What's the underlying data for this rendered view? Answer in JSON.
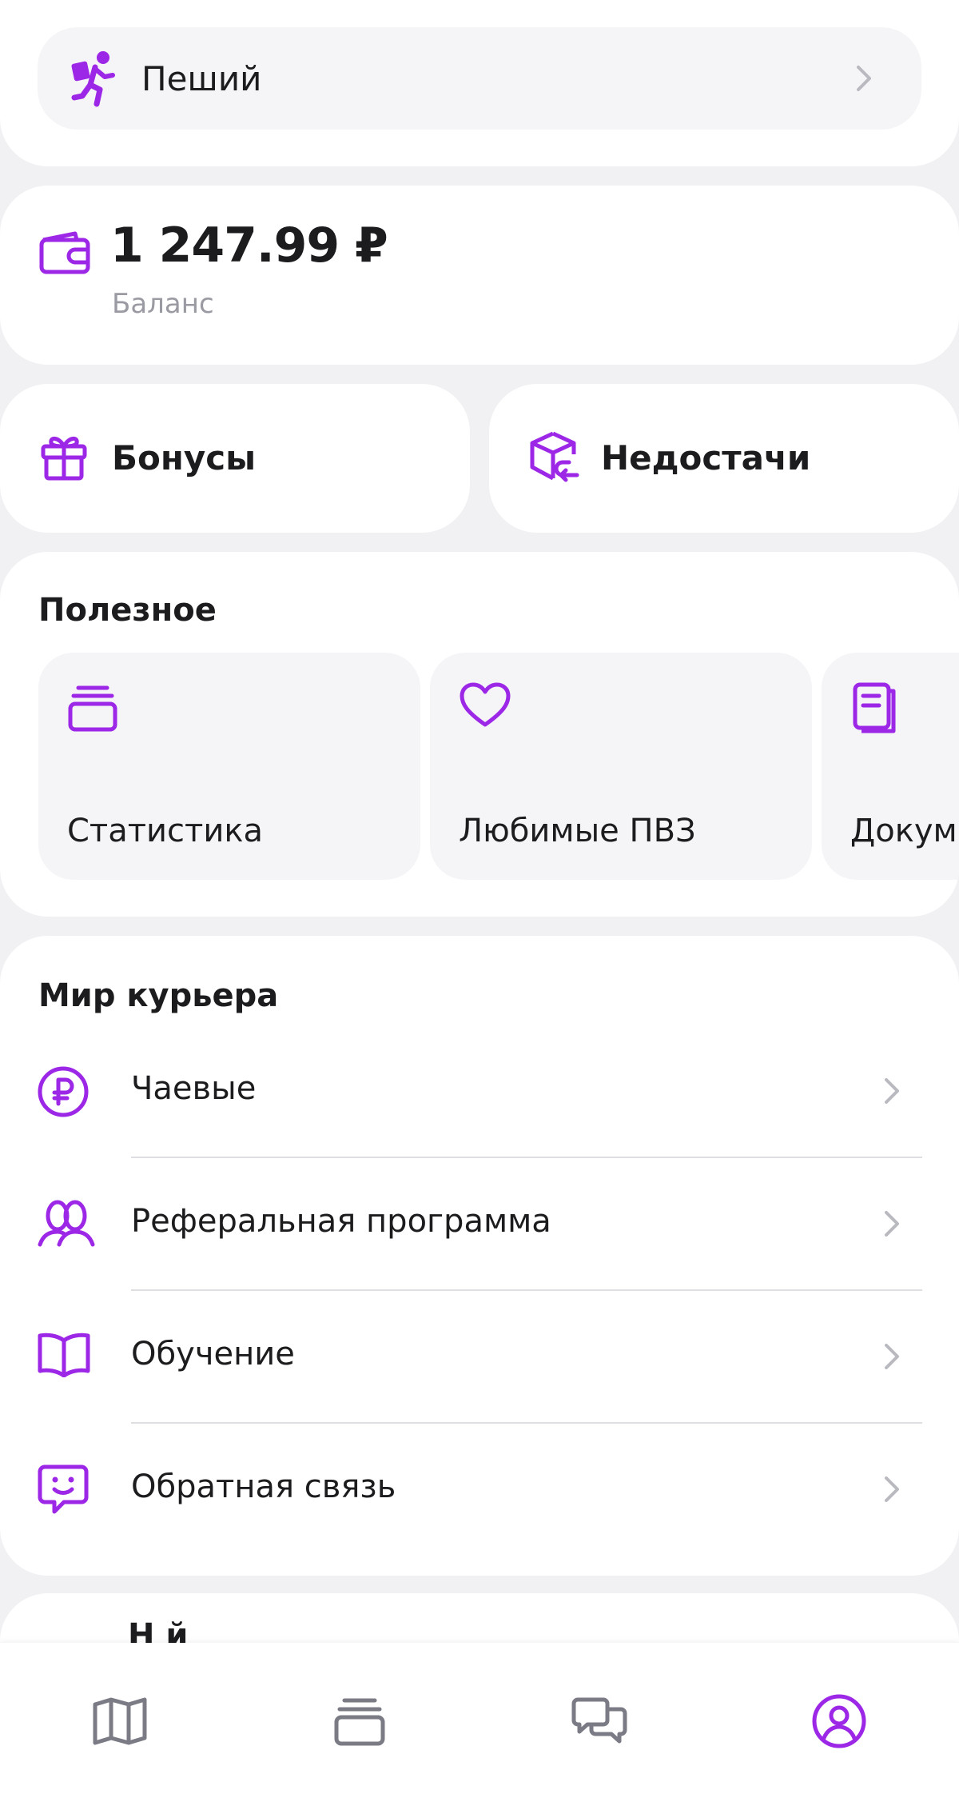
{
  "colors": {
    "accent": "#9c27e6",
    "background": "#f1f1f4",
    "card": "#ffffff",
    "tile": "#f5f5f8",
    "muted_text": "#9a9aa3",
    "nav_inactive": "#7b7b86"
  },
  "transport": {
    "icon": "walking-person-icon",
    "label": "Пеший"
  },
  "balance": {
    "icon": "wallet-icon",
    "amount": "1 247.99 ₽",
    "label": "Баланс"
  },
  "quick_actions": [
    {
      "icon": "gift-icon",
      "label": "Бонусы"
    },
    {
      "icon": "box-return-icon",
      "label": "Недостачи"
    }
  ],
  "useful": {
    "title": "Полезное",
    "tiles": [
      {
        "icon": "stack-icon",
        "label": "Статистика"
      },
      {
        "icon": "heart-icon",
        "label": "Любимые ПВЗ"
      },
      {
        "icon": "document-icon",
        "label": "Докум"
      }
    ]
  },
  "courier_world": {
    "title": "Мир курьера",
    "items": [
      {
        "icon": "ruble-circle-icon",
        "label": "Чаевые"
      },
      {
        "icon": "people-icon",
        "label": "Реферальная программа"
      },
      {
        "icon": "book-icon",
        "label": "Обучение"
      },
      {
        "icon": "feedback-chat-icon",
        "label": "Обратная связь"
      }
    ]
  },
  "next_section": {
    "title": "Н      й"
  },
  "bottom_nav": {
    "items": [
      {
        "icon": "map-icon",
        "active": false
      },
      {
        "icon": "stack-icon",
        "active": false
      },
      {
        "icon": "chat-icon",
        "active": false
      },
      {
        "icon": "profile-icon",
        "active": true
      }
    ]
  }
}
